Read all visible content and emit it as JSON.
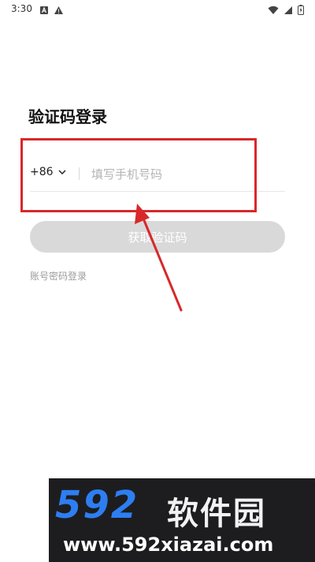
{
  "status_bar": {
    "time": "3:30",
    "left_icons": [
      "notification-a-icon",
      "warning-icon"
    ],
    "right_icons": [
      "wifi-icon",
      "signal-icon",
      "battery-charging-icon"
    ]
  },
  "login": {
    "title": "验证码登录",
    "country_code": "+86",
    "phone_placeholder": "填写手机号码",
    "phone_value": "",
    "get_code_label": "获取验证码",
    "password_login_label": "账号密码登录"
  },
  "annotation": {
    "highlight_color": "#d8282a"
  },
  "watermark": {
    "logo_text": "592",
    "site_name": "软件园",
    "url": "www.592xiazai.com"
  },
  "colors": {
    "accent_blue": "#2d7ef2",
    "button_disabled": "#d9d9d9",
    "link_gray": "#9c9c9c"
  }
}
